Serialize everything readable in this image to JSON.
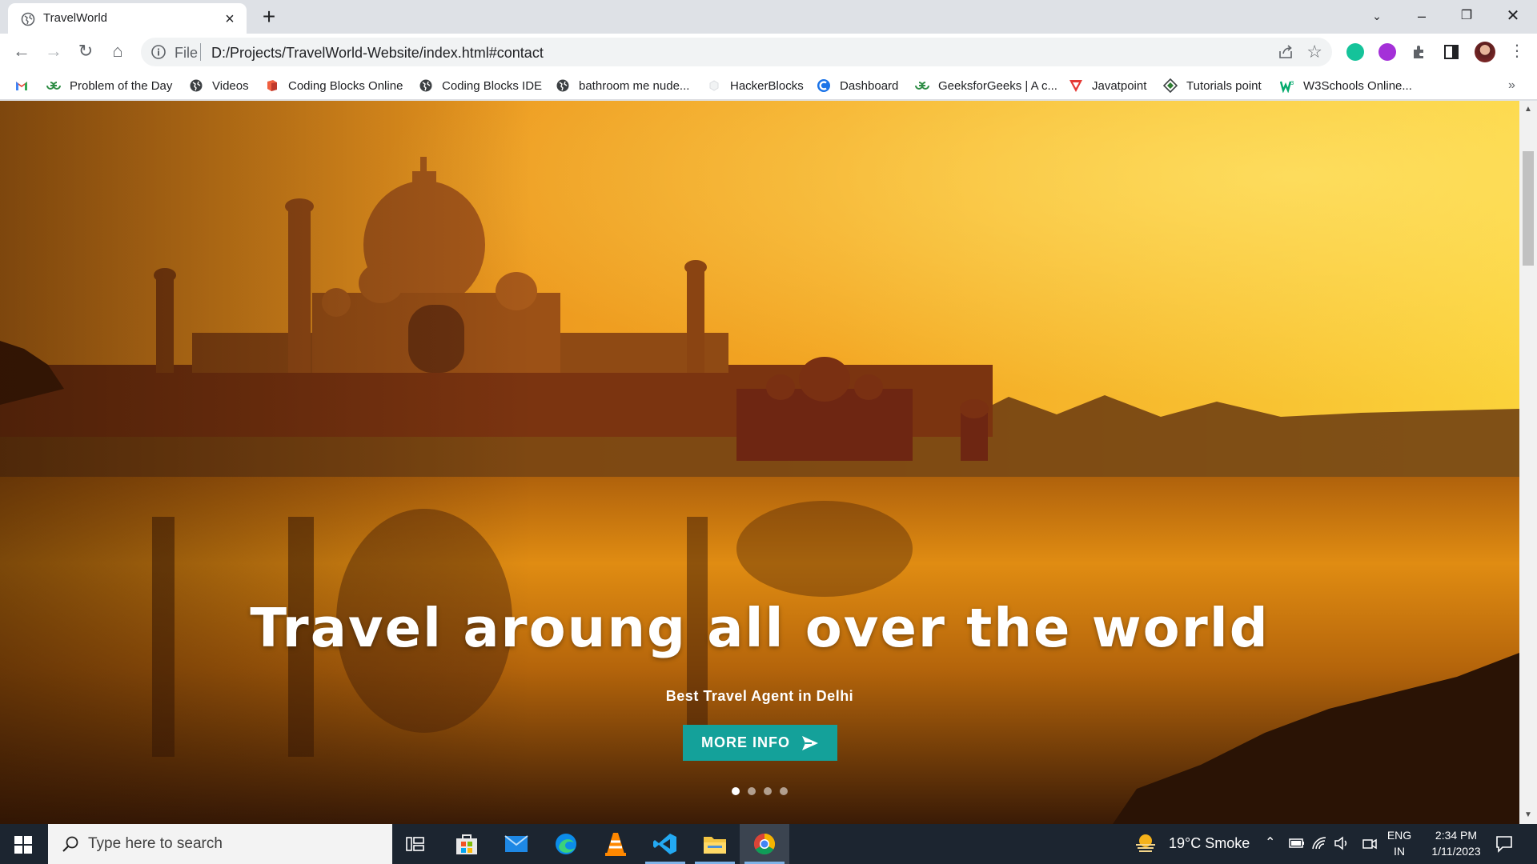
{
  "browser": {
    "tab_title": "TravelWorld",
    "url_scheme": "File",
    "url": "D:/Projects/TravelWorld-Website/index.html#contact"
  },
  "bookmarks": [
    {
      "label": "",
      "icon": "gmail-icon"
    },
    {
      "label": "Problem of the Day",
      "icon": "geeksforgeeks-icon"
    },
    {
      "label": "Videos",
      "icon": "globe-icon"
    },
    {
      "label": "Coding Blocks Online",
      "icon": "coding-blocks-icon"
    },
    {
      "label": "Coding Blocks IDE",
      "icon": "globe-icon"
    },
    {
      "label": "bathroom me nude...",
      "icon": "globe-icon"
    },
    {
      "label": "HackerBlocks",
      "icon": "hackerblocks-icon"
    },
    {
      "label": "Dashboard",
      "icon": "dashboard-icon"
    },
    {
      "label": "GeeksforGeeks | A c...",
      "icon": "geeksforgeeks-icon"
    },
    {
      "label": "Javatpoint",
      "icon": "javatpoint-icon"
    },
    {
      "label": "Tutorials point",
      "icon": "tutorialspoint-icon"
    },
    {
      "label": "W3Schools Online...",
      "icon": "w3schools-icon"
    }
  ],
  "hero": {
    "title": "Travel aroung all over the world",
    "subtitle": "Best Travel Agent in Delhi",
    "button_label": "MORE INFO",
    "slides": 4,
    "active_slide": 1
  },
  "taskbar": {
    "search_placeholder": "Type here to search",
    "weather": "19°C  Smoke",
    "lang_top": "ENG",
    "lang_bottom": "IN",
    "time": "2:34 PM",
    "date": "1/11/2023"
  },
  "colors": {
    "accent_button": "#14a19a",
    "taskbar": "#1c2530"
  }
}
